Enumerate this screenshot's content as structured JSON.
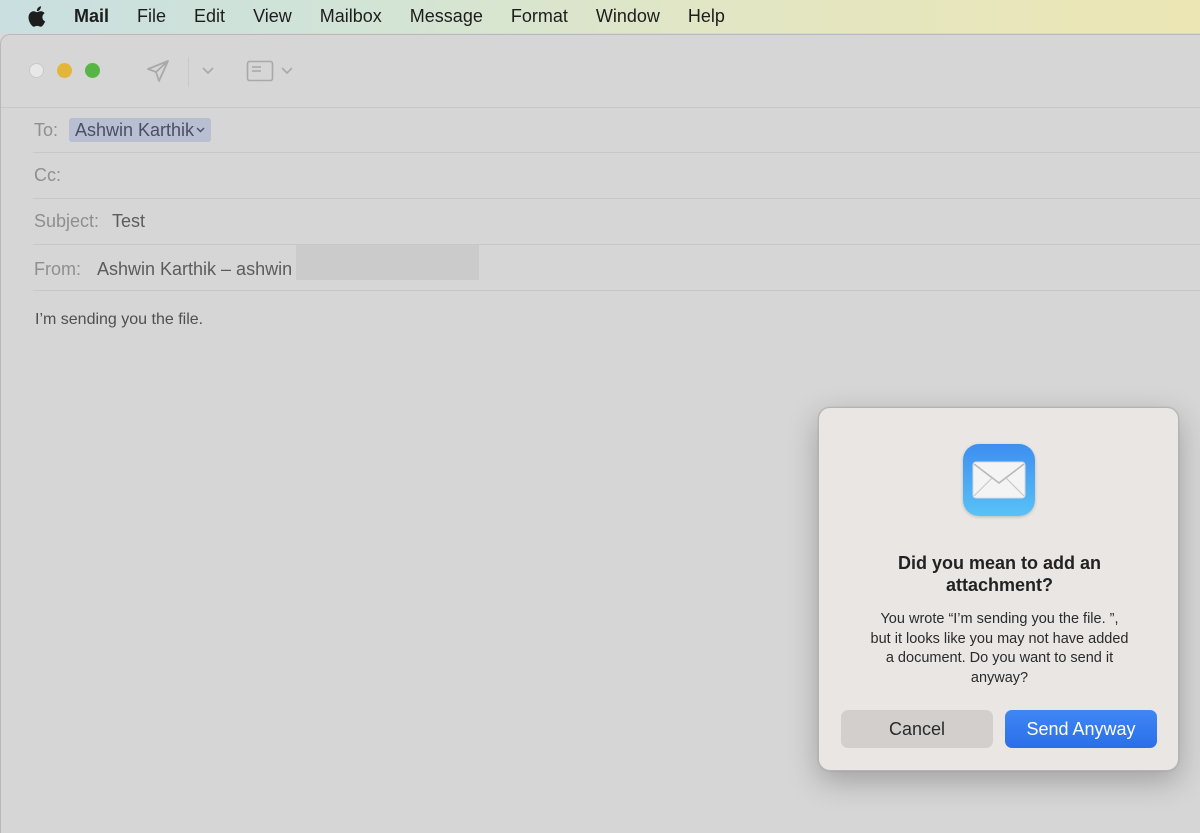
{
  "menubar": {
    "items": [
      "Mail",
      "File",
      "Edit",
      "View",
      "Mailbox",
      "Message",
      "Format",
      "Window",
      "Help"
    ]
  },
  "compose": {
    "to_label": "To:",
    "to_recipient": "Ashwin Karthik",
    "cc_label": "Cc:",
    "subject_label": "Subject:",
    "subject_value": "Test",
    "from_label": "From:",
    "from_value": "Ashwin Karthik – ashwin",
    "body": "I’m sending you the file."
  },
  "dialog": {
    "icon": "mail-envelope-icon",
    "title_line1": "Did you mean to add an",
    "title_line2": "attachment?",
    "message_line1": "You wrote “I’m sending you the file. ”,",
    "message_line2": "but it looks like you may not have added",
    "message_line3": "a document. Do you want to send it",
    "message_line4": "anyway?",
    "cancel_label": "Cancel",
    "send_label": "Send Anyway"
  },
  "colors": {
    "accent": "#2a6fe9",
    "token_bg": "#b9bfd2",
    "close_light": "#e8e8e8",
    "minimize_light": "#e3b63a",
    "maximize_light": "#56b545"
  }
}
